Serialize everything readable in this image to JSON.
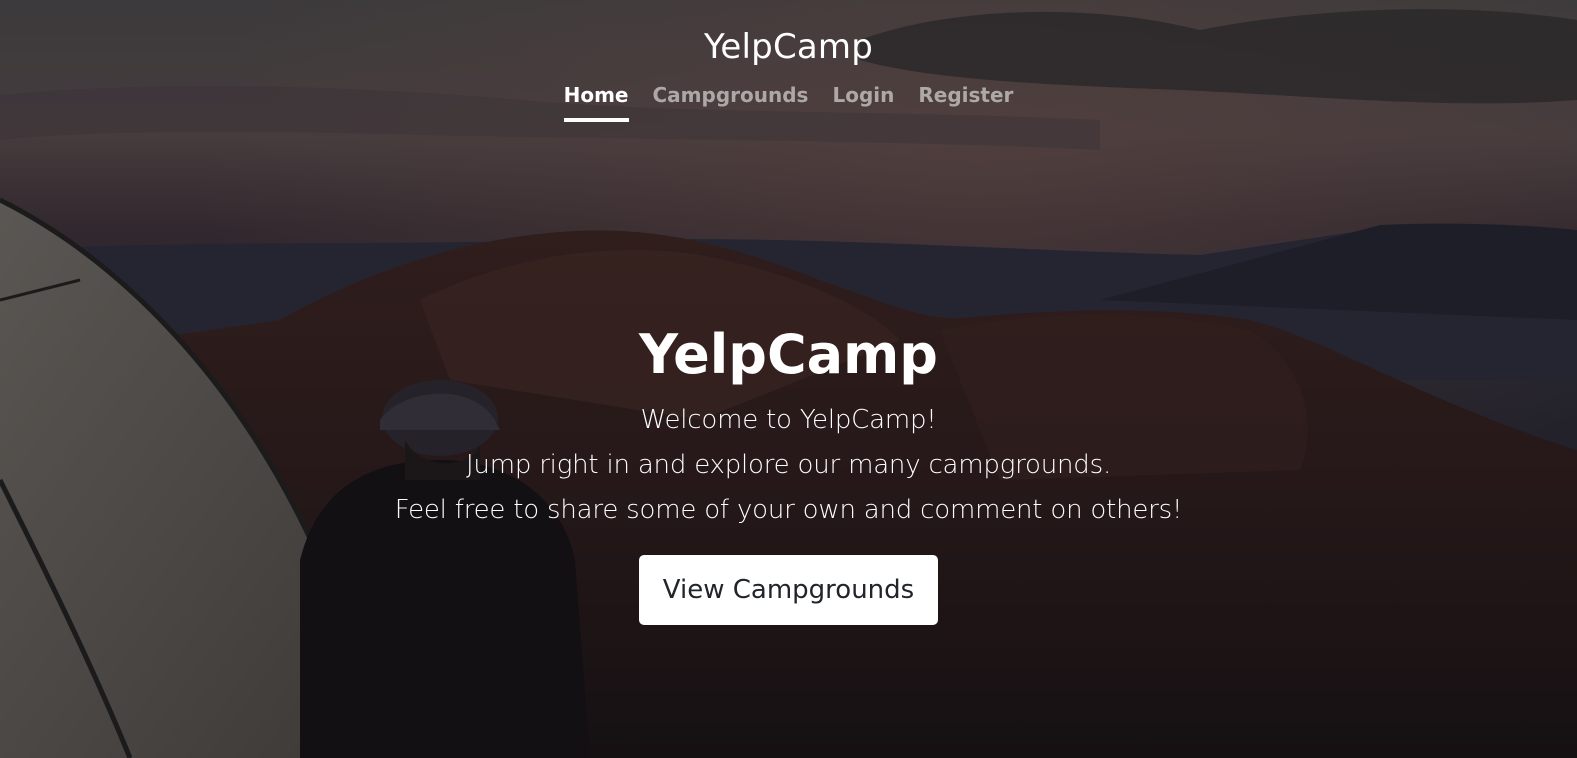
{
  "header": {
    "brand": "YelpCamp",
    "nav": [
      {
        "label": "Home",
        "active": true
      },
      {
        "label": "Campgrounds",
        "active": false
      },
      {
        "label": "Login",
        "active": false
      },
      {
        "label": "Register",
        "active": false
      }
    ]
  },
  "hero": {
    "title": "YelpCamp",
    "lines": [
      "Welcome to YelpCamp!",
      "Jump right in and explore our many campgrounds.",
      "Feel free to share some of your own and comment on others!"
    ],
    "cta_label": "View Campgrounds"
  },
  "colors": {
    "text": "#ffffff",
    "nav_inactive": "rgba(255,255,255,0.55)",
    "button_bg": "#ffffff",
    "button_text": "#212529"
  }
}
